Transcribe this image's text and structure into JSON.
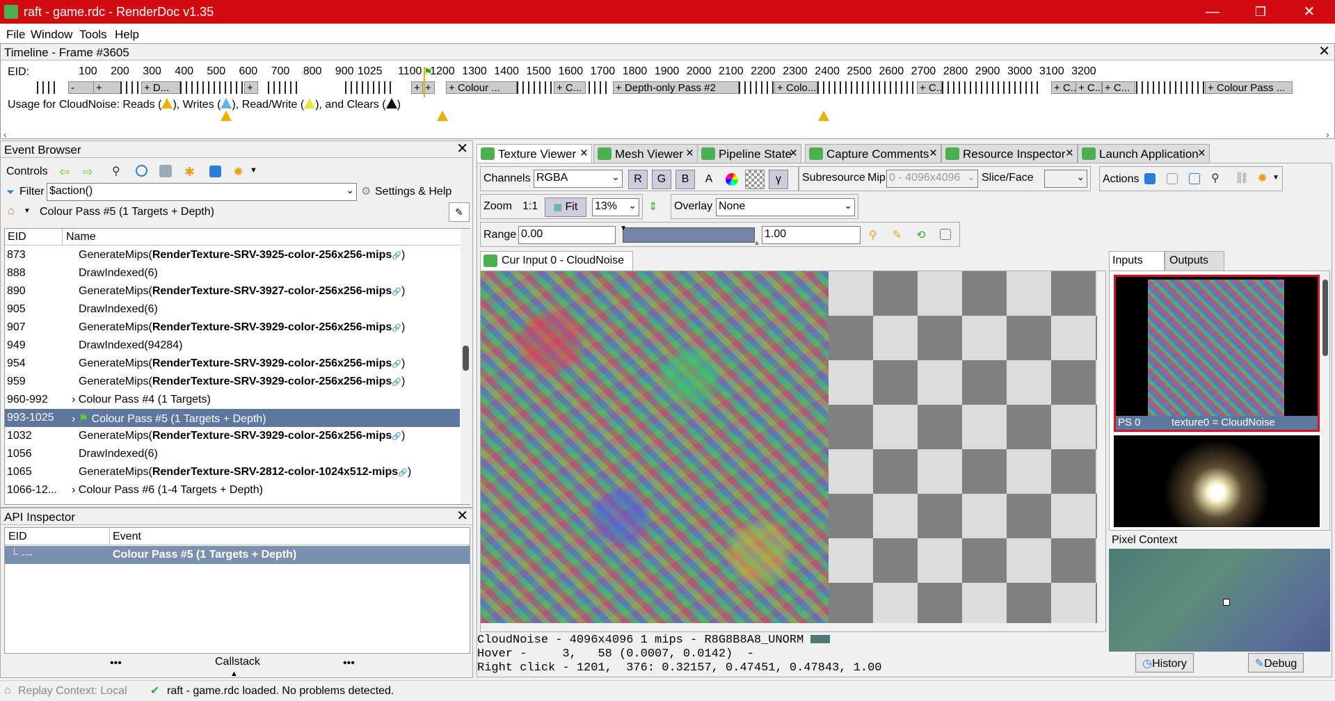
{
  "window": {
    "title": "raft - game.rdc - RenderDoc v1.35",
    "minimize": "—",
    "maximize": "❐",
    "close": "✕"
  },
  "menu": [
    "File",
    "Window",
    "Tools",
    "Help"
  ],
  "timeline": {
    "title": "Timeline - Frame #3605",
    "eid_label": "EID:",
    "ticks": [
      "100",
      "200",
      "300",
      "400",
      "500",
      "600",
      "700",
      "800",
      "900",
      "1025",
      "1100",
      "1200",
      "1300",
      "1400",
      "1500",
      "1600",
      "1700",
      "1800",
      "1900",
      "2000",
      "2100",
      "2200",
      "2300",
      "2400",
      "2500",
      "2600",
      "2700",
      "2800",
      "2900",
      "3000",
      "3100",
      "3200"
    ],
    "bars": [
      "-",
      "+",
      "+",
      "+ D...",
      "+",
      "+",
      "+",
      "+ Colour ...",
      "+ C...",
      "+ Depth-only Pass #2",
      "+ Colo...",
      "+ C...",
      "+ C...",
      "+ C...",
      "+ C...",
      "+ Colour Pass ..."
    ],
    "usage": "Usage for CloudNoise: Reads (",
    "usage2": "), Writes (",
    "usage3": "), Read/Write (",
    "usage4": "), and Clears (",
    "usage5": ")"
  },
  "event_browser": {
    "title": "Event Browser",
    "controls_label": "Controls",
    "filter_label": "Filter",
    "filter_value": "$action()",
    "settings_label": "Settings & Help",
    "breadcrumb": "Colour Pass #5 (1 Targets + Depth)",
    "col_eid": "EID",
    "col_name": "Name",
    "rows": [
      {
        "eid": "873",
        "name": "GenerateMips(",
        "bold": "RenderTexture-SRV-3925-color-256x256-mips",
        "tail": ")"
      },
      {
        "eid": "888",
        "name": "DrawIndexed(6)",
        "bold": "",
        "tail": ""
      },
      {
        "eid": "890",
        "name": "GenerateMips(",
        "bold": "RenderTexture-SRV-3927-color-256x256-mips",
        "tail": ")"
      },
      {
        "eid": "905",
        "name": "DrawIndexed(6)",
        "bold": "",
        "tail": ""
      },
      {
        "eid": "907",
        "name": "GenerateMips(",
        "bold": "RenderTexture-SRV-3929-color-256x256-mips",
        "tail": ")"
      },
      {
        "eid": "949",
        "name": "DrawIndexed(94284)",
        "bold": "",
        "tail": ""
      },
      {
        "eid": "954",
        "name": "GenerateMips(",
        "bold": "RenderTexture-SRV-3929-color-256x256-mips",
        "tail": ")"
      },
      {
        "eid": "959",
        "name": "GenerateMips(",
        "bold": "RenderTexture-SRV-3929-color-256x256-mips",
        "tail": ")"
      },
      {
        "eid": "960-992",
        "name": "Colour Pass #4 (1 Targets)",
        "bold": "",
        "tail": ""
      },
      {
        "eid": "993-1025",
        "name": "Colour Pass #5 (1 Targets + Depth)",
        "bold": "",
        "tail": ""
      },
      {
        "eid": "1032",
        "name": "GenerateMips(",
        "bold": "RenderTexture-SRV-3929-color-256x256-mips",
        "tail": ")"
      },
      {
        "eid": "1056",
        "name": "DrawIndexed(6)",
        "bold": "",
        "tail": ""
      },
      {
        "eid": "1065",
        "name": "GenerateMips(",
        "bold": "RenderTexture-SRV-2812-color-1024x512-mips",
        "tail": ")"
      },
      {
        "eid": "1066-12...",
        "name": "Colour Pass #6 (1-4 Targets + Depth)",
        "bold": "",
        "tail": ""
      }
    ]
  },
  "api_inspector": {
    "title": "API Inspector",
    "col_eid": "EID",
    "col_event": "Event",
    "row_eid": "└ ---",
    "row_event": "Colour Pass #5 (1 Targets + Depth)",
    "callstack": "Callstack",
    "dots": "•••"
  },
  "tabs": [
    "Texture Viewer",
    "Mesh Viewer",
    "Pipeline State",
    "Capture Comments",
    "Resource Inspector",
    "Launch Application"
  ],
  "texture_viewer": {
    "channels_label": "Channels",
    "channels_value": "RGBA",
    "channel_buttons": [
      "R",
      "G",
      "B",
      "A"
    ],
    "gamma": "γ",
    "subresource_label": "Subresource",
    "mip_label": "Mip",
    "mip_value": "0 - 4096x4096",
    "slice_label": "Slice/Face",
    "actions_label": "Actions",
    "zoom_label": "Zoom",
    "zoom_11": "1:1",
    "fit_label": "Fit",
    "zoom_value": "13%",
    "overlay_label": "Overlay",
    "overlay_value": "None",
    "range_label": "Range",
    "range_min": "0.00",
    "range_max": "1.00",
    "input_tab": "Cur Input 0 - CloudNoise",
    "status_line1": "CloudNoise - 4096x4096 1 mips - R8G8B8A8_UNORM",
    "status_line2": "Hover -     3,   58 (0.0007, 0.0142)  -",
    "status_line3": "Right click - 1201,  376: 0.32157, 0.47451, 0.47843, 1.00",
    "pick_color": "#4e7b79"
  },
  "thumbs": {
    "inputs_tab": "Inputs",
    "outputs_tab": "Outputs",
    "thumb0_slot": "PS 0",
    "thumb0_label": "texture0 = CloudNoise",
    "pixel_context": "Pixel Context",
    "history": "History",
    "debug": "Debug"
  },
  "statusbar": {
    "replay": "Replay Context: Local",
    "message": "raft - game.rdc loaded. No problems detected."
  }
}
